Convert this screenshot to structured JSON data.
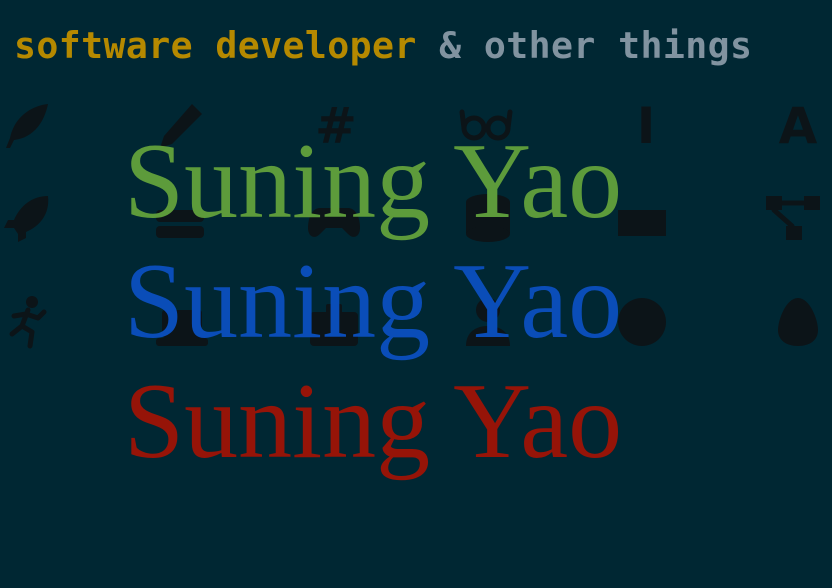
{
  "header": {
    "tagline_accent": "software developer",
    "tagline_rest": "& other things"
  },
  "hero": {
    "names": [
      {
        "text": "Suning Yao",
        "color": "#5d9b3b"
      },
      {
        "text": "Suning Yao",
        "color": "#0a4db8"
      },
      {
        "text": "Suning Yao",
        "color": "#961408"
      }
    ]
  },
  "colors": {
    "background": "#002733",
    "accent": "#b58900",
    "muted": "#8193a0",
    "icon": "#0c1418"
  },
  "background_icons": {
    "hash_glyph": "#",
    "cursor_glyph": "I",
    "letter_glyph": "A"
  }
}
